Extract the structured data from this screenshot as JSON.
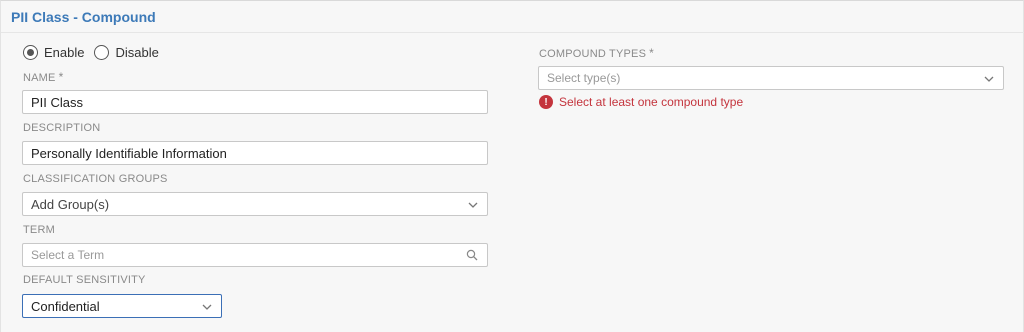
{
  "title": "PII Class - Compound",
  "status": {
    "enable_label": "Enable",
    "disable_label": "Disable",
    "selected": "enable"
  },
  "fields": {
    "name": {
      "label": "NAME",
      "required_mark": "*",
      "value": "PII Class"
    },
    "description": {
      "label": "DESCRIPTION",
      "value": "Personally Identifiable Information"
    },
    "classification_groups": {
      "label": "CLASSIFICATION GROUPS",
      "value": "Add Group(s)"
    },
    "term": {
      "label": "TERM",
      "placeholder": "Select a Term"
    },
    "default_sensitivity": {
      "label": "DEFAULT SENSITIVITY",
      "value": "Confidential"
    },
    "compound_types": {
      "label": "COMPOUND TYPES",
      "required_mark": "*",
      "placeholder": "Select type(s)",
      "error": "Select at least one compound type",
      "error_icon": "!"
    }
  },
  "colors": {
    "title": "#3d7ab8",
    "error": "#c4343d",
    "focus_border": "#3b6fb6"
  }
}
